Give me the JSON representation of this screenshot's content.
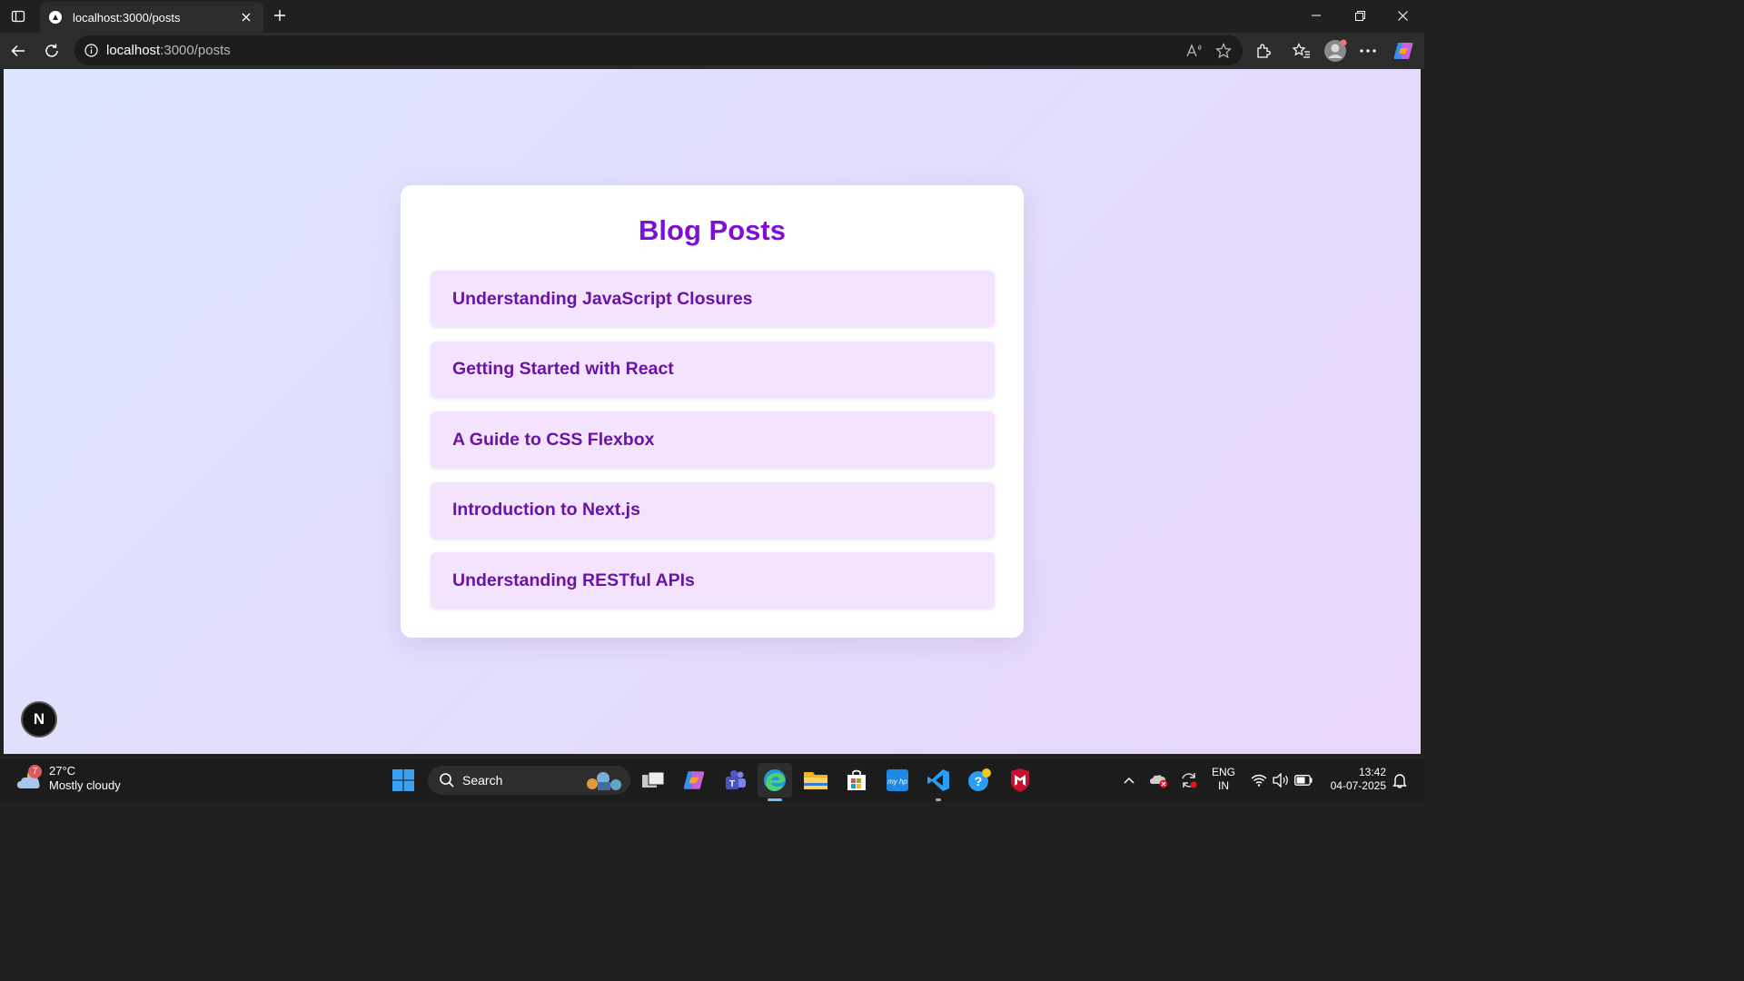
{
  "browser": {
    "tab_title": "localhost:3000/posts",
    "url_host": "localhost",
    "url_path": ":3000/posts"
  },
  "page": {
    "heading": "Blog Posts",
    "posts": [
      {
        "title": "Understanding JavaScript Closures"
      },
      {
        "title": "Getting Started with React"
      },
      {
        "title": "A Guide to CSS Flexbox"
      },
      {
        "title": "Introduction to Next.js"
      },
      {
        "title": "Understanding RESTful APIs"
      }
    ],
    "next_badge": "N"
  },
  "taskbar": {
    "weather_badge": "7",
    "temperature": "27°C",
    "condition": "Mostly cloudy",
    "search_label": "Search",
    "lang_primary": "ENG",
    "lang_secondary": "IN",
    "time": "13:42",
    "date": "04-07-2025"
  },
  "colors": {
    "heading": "#7e0fd4",
    "post_text": "#6a13a8",
    "post_bg": "#f3e3fc"
  }
}
